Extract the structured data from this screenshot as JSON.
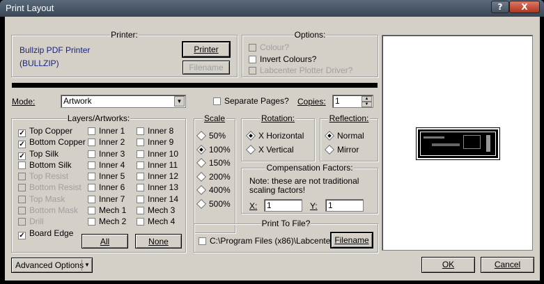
{
  "window": {
    "title": "Print Layout",
    "help": "?",
    "close": "X"
  },
  "printer": {
    "legend": "Printer:",
    "name": "Bullzip PDF Printer",
    "port": "(BULLZIP)",
    "printer_button": "Printer",
    "filename_button": "Filename"
  },
  "options": {
    "legend": "Options:",
    "colour": "Colour?",
    "invert": "Invert Colours?",
    "plotter": "Labcenter Plotter Driver?"
  },
  "mode": {
    "label": "Mode:",
    "value": "Artwork"
  },
  "separate_pages": "Separate Pages?",
  "copies": {
    "label": "Copies:",
    "value": "1"
  },
  "layers": {
    "legend": "Layers/Artworks:",
    "col1": [
      {
        "label": "Top Copper",
        "checked": true,
        "enabled": true
      },
      {
        "label": "Bottom Copper",
        "checked": true,
        "enabled": true
      },
      {
        "label": "Top Silk",
        "checked": true,
        "enabled": true
      },
      {
        "label": "Bottom Silk",
        "checked": false,
        "enabled": true
      },
      {
        "label": "Top Resist",
        "checked": false,
        "enabled": false
      },
      {
        "label": "Bottom Resist",
        "checked": false,
        "enabled": false
      },
      {
        "label": "Top Mask",
        "checked": false,
        "enabled": false
      },
      {
        "label": "Bottom Mask",
        "checked": false,
        "enabled": false
      },
      {
        "label": "Drill",
        "checked": false,
        "enabled": false
      },
      {
        "label": "Board Edge",
        "checked": true,
        "enabled": true
      }
    ],
    "col2": [
      "Inner 1",
      "Inner 2",
      "Inner 3",
      "Inner 4",
      "Inner 5",
      "Inner 6",
      "Inner 7",
      "Mech 1",
      "Mech 2"
    ],
    "col3": [
      "Inner 8",
      "Inner 9",
      "Inner 10",
      "Inner 11",
      "Inner 12",
      "Inner 13",
      "Inner 14",
      "Mech 3",
      "Mech 4"
    ],
    "all_button": "All",
    "none_button": "None"
  },
  "scale": {
    "legend": "Scale",
    "options": [
      "50%",
      "100%",
      "150%",
      "200%",
      "400%",
      "500%"
    ],
    "selected": "100%"
  },
  "rotation": {
    "legend": "Rotation:",
    "horizontal": "X Horizontal",
    "vertical": "X Vertical",
    "selected": "X Horizontal"
  },
  "reflection": {
    "legend": "Reflection:",
    "normal": "Normal",
    "mirror": "Mirror",
    "selected": "Normal"
  },
  "compensation": {
    "legend": "Compensation Factors:",
    "note_line1": "Note: these are not traditional",
    "note_line2": "scaling factors!",
    "x_label": "X:",
    "x_value": "1",
    "y_label": "Y:",
    "y_value": "1"
  },
  "print_to_file": {
    "legend": "Print To File?",
    "path": "C:\\Program Files (x86)\\Labcente",
    "filename_button": "Filename"
  },
  "advanced_options": "Advanced Options",
  "ok": "OK",
  "cancel": "Cancel"
}
